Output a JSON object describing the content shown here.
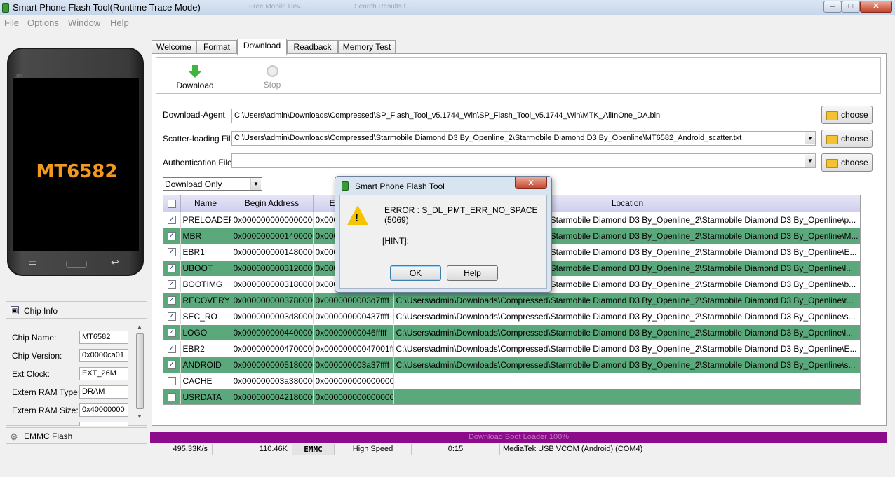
{
  "window": {
    "title": "Smart Phone Flash Tool(Runtime Trace Mode)",
    "ghost_tabs": [
      "Free Mobile Dev...",
      "Search Results f..."
    ]
  },
  "menu": [
    "File",
    "Options",
    "Window",
    "Help"
  ],
  "phone": {
    "brand": "BM",
    "model": "MT6582"
  },
  "tabs": [
    "Welcome",
    "Format",
    "Download",
    "Readback",
    "Memory Test"
  ],
  "toolbar": {
    "download": "Download",
    "stop": "Stop"
  },
  "files": {
    "agent_label": "Download-Agent",
    "agent_value": "C:\\Users\\admin\\Downloads\\Compressed\\SP_Flash_Tool_v5.1744_Win\\SP_Flash_Tool_v5.1744_Win\\MTK_AllInOne_DA.bin",
    "scatter_label": "Scatter-loading File",
    "scatter_value": "C:\\Users\\admin\\Downloads\\Compressed\\Starmobile  Diamond D3 By_Openline_2\\Starmobile  Diamond D3 By_Openline\\MT6582_Android_scatter.txt",
    "auth_label": "Authentication File",
    "auth_value": "",
    "choose": "choose"
  },
  "mode": "Download Only",
  "table": {
    "headers": [
      "Name",
      "Begin Address",
      "End Address",
      "Location"
    ],
    "rows": [
      {
        "name": "PRELOADER",
        "begin": "0x0000000000000000",
        "end": "0x000000000001ffff",
        "loc": "C:\\Users\\admin\\Downloads\\Compressed\\Starmobile  Diamond D3 By_Openline_2\\Starmobile  Diamond D3 By_Openline\\p...",
        "checked": true
      },
      {
        "name": "MBR",
        "begin": "0x0000000001400000",
        "end": "0x00000000013fffff",
        "loc": "C:\\Users\\admin\\Downloads\\Compressed\\Starmobile  Diamond D3 By_Openline_2\\Starmobile  Diamond D3 By_Openline\\M...",
        "checked": true
      },
      {
        "name": "EBR1",
        "begin": "0x0000000001480000",
        "end": "0x00000000014801ff",
        "loc": "C:\\Users\\admin\\Downloads\\Compressed\\Starmobile  Diamond D3 By_Openline_2\\Starmobile  Diamond D3 By_Openline\\E...",
        "checked": true
      },
      {
        "name": "UBOOT",
        "begin": "0x0000000003120000",
        "end": "0x000000000315ffff",
        "loc": "C:\\Users\\admin\\Downloads\\Compressed\\Starmobile  Diamond D3 By_Openline_2\\Starmobile  Diamond D3 By_Openline\\l...",
        "checked": true
      },
      {
        "name": "BOOTIMG",
        "begin": "0x0000000003180000",
        "end": "0x00000000036fffff",
        "loc": "C:\\Users\\admin\\Downloads\\Compressed\\Starmobile  Diamond D3 By_Openline_2\\Starmobile  Diamond D3 By_Openline\\b...",
        "checked": true
      },
      {
        "name": "RECOVERY",
        "begin": "0x0000000003780000",
        "end": "0x0000000003d7ffff",
        "loc": "C:\\Users\\admin\\Downloads\\Compressed\\Starmobile  Diamond D3 By_Openline_2\\Starmobile  Diamond D3 By_Openline\\r...",
        "checked": true
      },
      {
        "name": "SEC_RO",
        "begin": "0x0000000003d80000",
        "end": "0x000000000437ffff",
        "loc": "C:\\Users\\admin\\Downloads\\Compressed\\Starmobile  Diamond D3 By_Openline_2\\Starmobile  Diamond D3 By_Openline\\s...",
        "checked": true
      },
      {
        "name": "LOGO",
        "begin": "0x0000000004400000",
        "end": "0x00000000046fffff",
        "loc": "C:\\Users\\admin\\Downloads\\Compressed\\Starmobile  Diamond D3 By_Openline_2\\Starmobile  Diamond D3 By_Openline\\l...",
        "checked": true
      },
      {
        "name": "EBR2",
        "begin": "0x0000000004700000",
        "end": "0x00000000047001ff",
        "loc": "C:\\Users\\admin\\Downloads\\Compressed\\Starmobile  Diamond D3 By_Openline_2\\Starmobile  Diamond D3 By_Openline\\E...",
        "checked": true
      },
      {
        "name": "ANDROID",
        "begin": "0x0000000005180000",
        "end": "0x000000003a37ffff",
        "loc": "C:\\Users\\admin\\Downloads\\Compressed\\Starmobile  Diamond D3 By_Openline_2\\Starmobile  Diamond D3 By_Openline\\s...",
        "checked": true
      },
      {
        "name": "CACHE",
        "begin": "0x000000003a380000",
        "end": "0x0000000000000000",
        "loc": "",
        "checked": false
      },
      {
        "name": "USRDATA",
        "begin": "0x0000000042180000",
        "end": "0x0000000000000000",
        "loc": "",
        "checked": false
      }
    ]
  },
  "chip_info": {
    "title": "Chip Info",
    "rows": [
      {
        "label": "Chip Name:",
        "value": "MT6582"
      },
      {
        "label": "Chip Version:",
        "value": "0x0000ca01"
      },
      {
        "label": "Ext Clock:",
        "value": "EXT_26M"
      },
      {
        "label": "Extern RAM Type:",
        "value": "DRAM"
      },
      {
        "label": "Extern RAM Size:",
        "value": "0x40000000"
      }
    ]
  },
  "emmc_flash": "EMMC Flash",
  "dialog": {
    "title": "Smart Phone Flash Tool",
    "error": "ERROR : S_DL_PMT_ERR_NO_SPACE (5069)",
    "hint": "[HINT]:",
    "ok": "OK",
    "help": "Help"
  },
  "progress": {
    "text": "Download Boot Loader 100%",
    "fraction": 1.0
  },
  "status": {
    "speed": "495.33K/s",
    "size": "110.46K",
    "storage": "EMMC",
    "mode": "High Speed",
    "time": "0:15",
    "port": "MediaTek USB VCOM (Android) (COM4)"
  },
  "colors": {
    "row_alt": "#5aa87c",
    "progress": "#8b0b8b",
    "logo_text": "#f39a1e"
  }
}
